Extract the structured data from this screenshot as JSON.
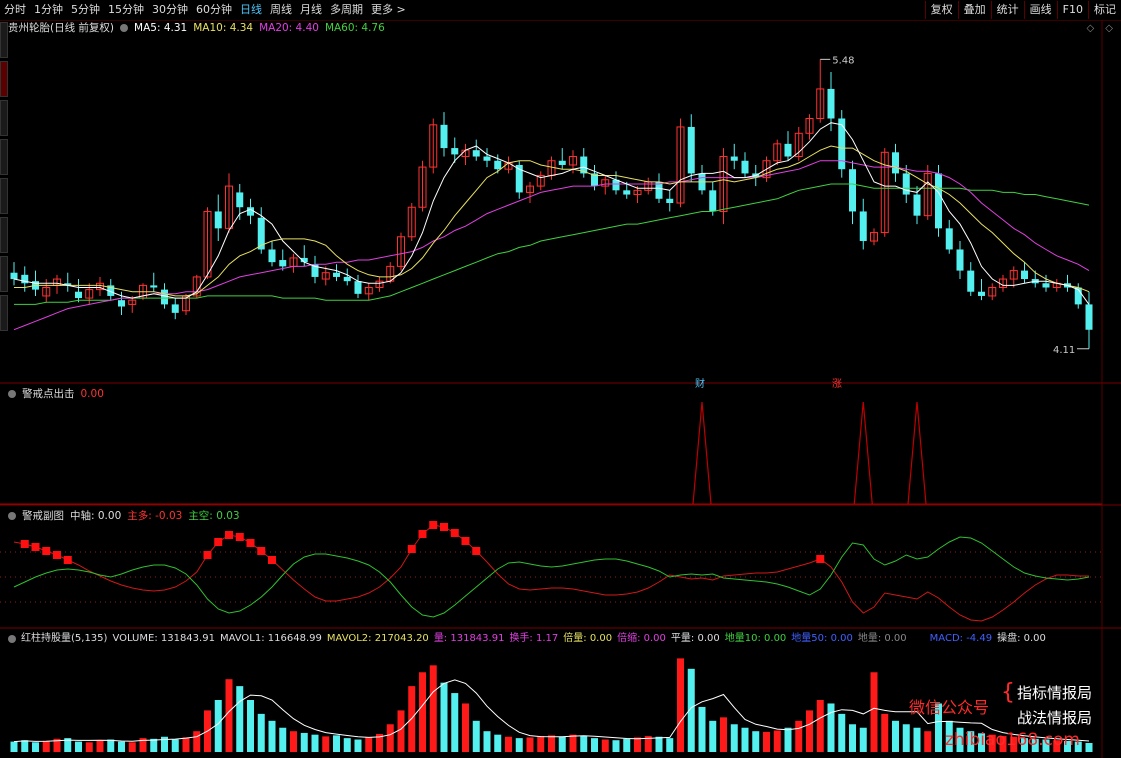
{
  "toolbar": {
    "timeframes": [
      "分时",
      "1分钟",
      "5分钟",
      "15分钟",
      "30分钟",
      "60分钟",
      "日线",
      "周线",
      "月线",
      "多周期",
      "更多 >"
    ],
    "active": "日线",
    "right_buttons": [
      "复权",
      "叠加",
      "统计",
      "画线",
      "F10",
      "标记"
    ]
  },
  "price_header": {
    "title": "贵州轮胎(日线 前复权)",
    "ma5": "MA5: 4.31",
    "ma10": "MA10: 4.34",
    "ma20": "MA20: 4.40",
    "ma60": "MA60: 4.76"
  },
  "alert_header": {
    "title": "警戒点出击",
    "value": "0.00"
  },
  "osc_header": {
    "title": "警戒副图",
    "mid": "中轴: 0.00",
    "long": "主多: -0.03",
    "short": "主空: 0.03"
  },
  "vol_header": {
    "title": "红柱持股量(5,135)",
    "volume": "VOLUME: 131843.91",
    "mavol1": "MAVOL1: 116648.99",
    "mavol2": "MAVOL2: 217043.20",
    "liang": "量: 131843.91",
    "huanshou": "换手: 1.17",
    "beiliang": "倍量: 0.00",
    "beisuo": "倍缩: 0.00",
    "pingliang": "平量: 0.00",
    "dibiliang": "地量10: 0.00",
    "dibi50": "地量50: 0.00",
    "diliang": "地量: 0.00",
    "macd": "MACD: -4.49",
    "caopan": "操盘: 0.00"
  },
  "markers": {
    "cai": "财",
    "zhang": "涨"
  },
  "watermark": {
    "line1": "微信公众号",
    "brace": "{",
    "line2": "指标情报局",
    "line3": "战法情报局",
    "url": "zhibiao168.com"
  },
  "colors": {
    "up": "#ff3232",
    "down": "#54f0f0",
    "ma5": "#ffffff",
    "ma10": "#e8e060",
    "ma20": "#e040e0",
    "ma60": "#40d040"
  },
  "chart_data": {
    "type": "candlestick",
    "high_label": "5.48",
    "low_label": "4.11",
    "ylim": [
      4.0,
      5.6
    ],
    "candles": [
      [
        4.47,
        4.52,
        4.41,
        4.44
      ],
      [
        4.46,
        4.5,
        4.38,
        4.42
      ],
      [
        4.43,
        4.48,
        4.36,
        4.39
      ],
      [
        4.36,
        4.44,
        4.33,
        4.4
      ],
      [
        4.41,
        4.46,
        4.37,
        4.44
      ],
      [
        4.42,
        4.47,
        4.38,
        4.41
      ],
      [
        4.38,
        4.44,
        4.33,
        4.35
      ],
      [
        4.35,
        4.42,
        4.32,
        4.39
      ],
      [
        4.39,
        4.45,
        4.36,
        4.42
      ],
      [
        4.41,
        4.44,
        4.34,
        4.36
      ],
      [
        4.34,
        4.38,
        4.27,
        4.31
      ],
      [
        4.32,
        4.36,
        4.28,
        4.34
      ],
      [
        4.35,
        4.42,
        4.34,
        4.41
      ],
      [
        4.41,
        4.47,
        4.38,
        4.4
      ],
      [
        4.39,
        4.42,
        4.3,
        4.32
      ],
      [
        4.32,
        4.35,
        4.25,
        4.28
      ],
      [
        4.29,
        4.37,
        4.27,
        4.36
      ],
      [
        4.36,
        4.46,
        4.35,
        4.45
      ],
      [
        4.45,
        4.78,
        4.44,
        4.76
      ],
      [
        4.76,
        4.84,
        4.62,
        4.68
      ],
      [
        4.68,
        4.94,
        4.66,
        4.88
      ],
      [
        4.85,
        4.89,
        4.72,
        4.78
      ],
      [
        4.78,
        4.82,
        4.7,
        4.74
      ],
      [
        4.73,
        4.78,
        4.56,
        4.58
      ],
      [
        4.58,
        4.62,
        4.5,
        4.52
      ],
      [
        4.53,
        4.58,
        4.48,
        4.5
      ],
      [
        4.5,
        4.56,
        4.47,
        4.54
      ],
      [
        4.54,
        4.6,
        4.5,
        4.52
      ],
      [
        4.51,
        4.55,
        4.42,
        4.45
      ],
      [
        4.44,
        4.5,
        4.41,
        4.47
      ],
      [
        4.47,
        4.51,
        4.43,
        4.45
      ],
      [
        4.45,
        4.49,
        4.41,
        4.43
      ],
      [
        4.43,
        4.46,
        4.35,
        4.37
      ],
      [
        4.37,
        4.42,
        4.34,
        4.4
      ],
      [
        4.4,
        4.45,
        4.38,
        4.43
      ],
      [
        4.43,
        4.52,
        4.42,
        4.5
      ],
      [
        4.5,
        4.66,
        4.48,
        4.64
      ],
      [
        4.64,
        4.8,
        4.62,
        4.78
      ],
      [
        4.78,
        5.0,
        4.76,
        4.97
      ],
      [
        4.97,
        5.2,
        4.94,
        5.17
      ],
      [
        5.17,
        5.23,
        5.02,
        5.06
      ],
      [
        5.06,
        5.11,
        4.99,
        5.03
      ],
      [
        5.02,
        5.08,
        4.98,
        5.05
      ],
      [
        5.05,
        5.1,
        5.0,
        5.02
      ],
      [
        5.02,
        5.06,
        4.97,
        5.0
      ],
      [
        5.0,
        5.03,
        4.94,
        4.96
      ],
      [
        4.96,
        5.02,
        4.94,
        4.99
      ],
      [
        4.98,
        5.0,
        4.82,
        4.85
      ],
      [
        4.85,
        4.9,
        4.8,
        4.88
      ],
      [
        4.88,
        4.95,
        4.86,
        4.93
      ],
      [
        4.93,
        5.02,
        4.91,
        5.0
      ],
      [
        5.0,
        5.06,
        4.96,
        4.98
      ],
      [
        4.98,
        5.05,
        4.94,
        5.02
      ],
      [
        5.02,
        5.06,
        4.92,
        4.94
      ],
      [
        4.94,
        4.98,
        4.86,
        4.88
      ],
      [
        4.88,
        4.93,
        4.84,
        4.91
      ],
      [
        4.91,
        4.95,
        4.84,
        4.86
      ],
      [
        4.86,
        4.9,
        4.82,
        4.84
      ],
      [
        4.84,
        4.88,
        4.8,
        4.86
      ],
      [
        4.86,
        4.92,
        4.84,
        4.9
      ],
      [
        4.9,
        4.94,
        4.8,
        4.82
      ],
      [
        4.82,
        4.86,
        4.76,
        4.8
      ],
      [
        4.8,
        5.2,
        4.78,
        5.16
      ],
      [
        5.16,
        5.22,
        4.9,
        4.94
      ],
      [
        4.94,
        4.98,
        4.84,
        4.86
      ],
      [
        4.86,
        4.9,
        4.74,
        4.76
      ],
      [
        4.76,
        5.06,
        4.7,
        5.02
      ],
      [
        5.02,
        5.08,
        4.96,
        5.0
      ],
      [
        5.0,
        5.04,
        4.92,
        4.94
      ],
      [
        4.94,
        4.98,
        4.88,
        4.92
      ],
      [
        4.92,
        5.02,
        4.9,
        5.0
      ],
      [
        5.0,
        5.1,
        4.98,
        5.08
      ],
      [
        5.08,
        5.14,
        5.0,
        5.02
      ],
      [
        5.02,
        5.16,
        5.0,
        5.13
      ],
      [
        5.13,
        5.22,
        5.1,
        5.2
      ],
      [
        5.2,
        5.48,
        5.18,
        5.34
      ],
      [
        5.34,
        5.42,
        5.14,
        5.2
      ],
      [
        5.2,
        5.24,
        4.92,
        4.96
      ],
      [
        4.96,
        5.0,
        4.7,
        4.76
      ],
      [
        4.76,
        4.82,
        4.58,
        4.62
      ],
      [
        4.62,
        4.68,
        4.6,
        4.66
      ],
      [
        4.66,
        5.06,
        4.64,
        5.04
      ],
      [
        5.04,
        5.08,
        4.9,
        4.94
      ],
      [
        4.94,
        4.98,
        4.8,
        4.84
      ],
      [
        4.84,
        4.88,
        4.7,
        4.74
      ],
      [
        4.74,
        4.98,
        4.72,
        4.94
      ],
      [
        4.94,
        4.98,
        4.64,
        4.68
      ],
      [
        4.68,
        4.72,
        4.56,
        4.58
      ],
      [
        4.58,
        4.62,
        4.44,
        4.48
      ],
      [
        4.48,
        4.52,
        4.36,
        4.38
      ],
      [
        4.38,
        4.44,
        4.34,
        4.36
      ],
      [
        4.36,
        4.42,
        4.34,
        4.4
      ],
      [
        4.4,
        4.46,
        4.38,
        4.44
      ],
      [
        4.44,
        4.5,
        4.4,
        4.48
      ],
      [
        4.48,
        4.52,
        4.42,
        4.44
      ],
      [
        4.44,
        4.48,
        4.4,
        4.42
      ],
      [
        4.42,
        4.46,
        4.38,
        4.4
      ],
      [
        4.4,
        4.44,
        4.38,
        4.42
      ],
      [
        4.42,
        4.46,
        4.38,
        4.4
      ],
      [
        4.4,
        4.42,
        4.3,
        4.32
      ],
      [
        4.32,
        4.38,
        4.11,
        4.2
      ]
    ],
    "ma5": [
      4.44,
      4.43,
      4.42,
      4.42,
      4.42,
      4.41,
      4.4,
      4.4,
      4.4,
      4.38,
      4.36,
      4.35,
      4.36,
      4.37,
      4.36,
      4.35,
      4.35,
      4.38,
      4.46,
      4.55,
      4.67,
      4.75,
      4.77,
      4.74,
      4.7,
      4.62,
      4.57,
      4.52,
      4.5,
      4.49,
      4.48,
      4.46,
      4.43,
      4.42,
      4.42,
      4.43,
      4.47,
      4.55,
      4.66,
      4.81,
      4.92,
      5.0,
      5.05,
      5.07,
      5.03,
      5.01,
      4.99,
      4.96,
      4.94,
      4.92,
      4.93,
      4.94,
      4.96,
      4.97,
      4.95,
      4.93,
      4.91,
      4.89,
      4.87,
      4.87,
      4.87,
      4.86,
      4.91,
      4.93,
      4.94,
      4.94,
      4.95,
      4.92,
      4.92,
      4.93,
      4.96,
      4.99,
      5.0,
      5.04,
      5.09,
      5.15,
      5.18,
      5.17,
      5.1,
      5.0,
      4.9,
      4.88,
      4.88,
      4.86,
      4.85,
      4.9,
      4.85,
      4.76,
      4.7,
      4.61,
      4.5,
      4.44,
      4.41,
      4.41,
      4.42,
      4.43,
      4.43,
      4.42,
      4.41,
      4.39,
      4.32
    ],
    "ma10": [
      4.4,
      4.4,
      4.41,
      4.41,
      4.41,
      4.41,
      4.41,
      4.41,
      4.41,
      4.4,
      4.39,
      4.38,
      4.38,
      4.38,
      4.37,
      4.36,
      4.36,
      4.37,
      4.41,
      4.45,
      4.51,
      4.55,
      4.57,
      4.6,
      4.62,
      4.63,
      4.63,
      4.63,
      4.62,
      4.6,
      4.55,
      4.51,
      4.48,
      4.46,
      4.45,
      4.45,
      4.46,
      4.49,
      4.54,
      4.61,
      4.67,
      4.74,
      4.8,
      4.86,
      4.92,
      4.95,
      4.99,
      5.0,
      5.0,
      4.98,
      4.97,
      4.96,
      4.96,
      4.95,
      4.93,
      4.93,
      4.93,
      4.92,
      4.91,
      4.9,
      4.9,
      4.89,
      4.9,
      4.9,
      4.9,
      4.9,
      4.91,
      4.9,
      4.91,
      4.92,
      4.94,
      4.96,
      4.97,
      4.99,
      5.02,
      5.05,
      5.07,
      5.06,
      5.06,
      5.03,
      5.0,
      4.98,
      4.97,
      4.95,
      4.92,
      4.89,
      4.87,
      4.84,
      4.8,
      4.75,
      4.7,
      4.66,
      4.61,
      4.56,
      4.52,
      4.47,
      4.44,
      4.42,
      4.41,
      4.4,
      4.38
    ],
    "ma20": [
      4.2,
      4.22,
      4.24,
      4.26,
      4.28,
      4.3,
      4.31,
      4.32,
      4.33,
      4.34,
      4.35,
      4.35,
      4.36,
      4.37,
      4.37,
      4.37,
      4.38,
      4.38,
      4.39,
      4.41,
      4.43,
      4.45,
      4.46,
      4.47,
      4.48,
      4.49,
      4.5,
      4.5,
      4.51,
      4.51,
      4.52,
      4.52,
      4.53,
      4.53,
      4.54,
      4.55,
      4.56,
      4.57,
      4.59,
      4.62,
      4.64,
      4.67,
      4.69,
      4.72,
      4.75,
      4.77,
      4.79,
      4.81,
      4.83,
      4.85,
      4.86,
      4.87,
      4.88,
      4.88,
      4.88,
      4.89,
      4.89,
      4.89,
      4.89,
      4.89,
      4.89,
      4.9,
      4.9,
      4.91,
      4.92,
      4.92,
      4.92,
      4.92,
      4.92,
      4.92,
      4.93,
      4.94,
      4.95,
      4.96,
      4.98,
      5.0,
      5.0,
      5.0,
      4.99,
      4.98,
      4.97,
      4.97,
      4.97,
      4.96,
      4.95,
      4.95,
      4.94,
      4.92,
      4.89,
      4.85,
      4.8,
      4.76,
      4.72,
      4.68,
      4.65,
      4.61,
      4.58,
      4.55,
      4.53,
      4.51,
      4.48
    ],
    "ma60": [
      4.32,
      4.32,
      4.32,
      4.33,
      4.33,
      4.33,
      4.34,
      4.34,
      4.34,
      4.34,
      4.35,
      4.35,
      4.35,
      4.35,
      4.35,
      4.35,
      4.35,
      4.35,
      4.36,
      4.36,
      4.36,
      4.36,
      4.36,
      4.36,
      4.36,
      4.35,
      4.35,
      4.35,
      4.35,
      4.34,
      4.34,
      4.34,
      4.34,
      4.34,
      4.35,
      4.36,
      4.38,
      4.4,
      4.42,
      4.44,
      4.46,
      4.48,
      4.5,
      4.52,
      4.54,
      4.56,
      4.57,
      4.59,
      4.6,
      4.62,
      4.63,
      4.64,
      4.65,
      4.66,
      4.67,
      4.68,
      4.69,
      4.7,
      4.7,
      4.71,
      4.72,
      4.73,
      4.74,
      4.75,
      4.76,
      4.76,
      4.77,
      4.78,
      4.79,
      4.8,
      4.81,
      4.82,
      4.84,
      4.86,
      4.87,
      4.88,
      4.89,
      4.89,
      4.89,
      4.88,
      4.87,
      4.87,
      4.87,
      4.87,
      4.87,
      4.87,
      4.87,
      4.87,
      4.87,
      4.86,
      4.86,
      4.86,
      4.85,
      4.85,
      4.84,
      4.84,
      4.83,
      4.82,
      4.81,
      4.8,
      4.79
    ],
    "alert_spikes": [
      64,
      79,
      84
    ],
    "osc_red": [
      0.35,
      0.33,
      0.3,
      0.26,
      0.22,
      0.17,
      0.12,
      0.06,
      0.01,
      -0.04,
      -0.08,
      -0.11,
      -0.13,
      -0.14,
      -0.13,
      -0.1,
      -0.04,
      0.05,
      0.22,
      0.35,
      0.42,
      0.4,
      0.34,
      0.26,
      0.17,
      0.07,
      -0.03,
      -0.12,
      -0.2,
      -0.24,
      -0.24,
      -0.22,
      -0.2,
      -0.16,
      -0.1,
      -0.01,
      0.1,
      0.28,
      0.43,
      0.52,
      0.5,
      0.44,
      0.36,
      0.26,
      0.15,
      0.03,
      -0.07,
      -0.12,
      -0.13,
      -0.12,
      -0.11,
      -0.11,
      -0.12,
      -0.14,
      -0.16,
      -0.18,
      -0.18,
      -0.17,
      -0.15,
      -0.11,
      -0.05,
      0.02,
      0.0,
      -0.02,
      -0.01,
      -0.03,
      0.01,
      0.02,
      0.03,
      0.04,
      0.04,
      0.05,
      0.08,
      0.11,
      0.14,
      0.18,
      0.1,
      -0.05,
      -0.25,
      -0.36,
      -0.3,
      -0.16,
      -0.18,
      -0.2,
      -0.22,
      -0.15,
      -0.21,
      -0.3,
      -0.38,
      -0.43,
      -0.44,
      -0.4,
      -0.33,
      -0.25,
      -0.16,
      -0.08,
      -0.02,
      0.02,
      0.02,
      0.01,
      0.01
    ],
    "osc_green": [
      -0.1,
      -0.05,
      0.0,
      0.04,
      0.07,
      0.08,
      0.07,
      0.05,
      0.02,
      0.0,
      0.03,
      0.07,
      0.1,
      0.12,
      0.12,
      0.09,
      0.03,
      -0.08,
      -0.22,
      -0.32,
      -0.36,
      -0.34,
      -0.28,
      -0.2,
      -0.1,
      0.02,
      0.13,
      0.2,
      0.23,
      0.23,
      0.21,
      0.19,
      0.16,
      0.12,
      0.05,
      -0.05,
      -0.18,
      -0.3,
      -0.38,
      -0.4,
      -0.36,
      -0.28,
      -0.19,
      -0.1,
      -0.01,
      0.08,
      0.14,
      0.15,
      0.13,
      0.11,
      0.1,
      0.11,
      0.13,
      0.15,
      0.17,
      0.18,
      0.18,
      0.16,
      0.13,
      0.1,
      0.06,
      0.0,
      0.02,
      0.03,
      0.02,
      0.03,
      -0.01,
      -0.02,
      -0.03,
      -0.04,
      -0.05,
      -0.07,
      -0.1,
      -0.14,
      -0.18,
      -0.12,
      0.02,
      0.2,
      0.34,
      0.32,
      0.18,
      0.12,
      0.16,
      0.22,
      0.18,
      0.2,
      0.28,
      0.35,
      0.4,
      0.39,
      0.34,
      0.26,
      0.18,
      0.1,
      0.04,
      0.01,
      -0.01,
      -0.02,
      -0.03,
      -0.02,
      0.0
    ],
    "volume": [
      30,
      34,
      28,
      32,
      38,
      40,
      30,
      28,
      34,
      36,
      30,
      28,
      40,
      38,
      44,
      36,
      42,
      60,
      120,
      150,
      210,
      190,
      150,
      110,
      90,
      70,
      60,
      55,
      50,
      45,
      48,
      40,
      36,
      42,
      52,
      80,
      120,
      190,
      230,
      250,
      200,
      170,
      140,
      90,
      60,
      50,
      44,
      40,
      42,
      46,
      48,
      44,
      50,
      46,
      40,
      36,
      34,
      38,
      42,
      46,
      44,
      40,
      270,
      240,
      130,
      90,
      100,
      80,
      70,
      60,
      58,
      62,
      70,
      90,
      120,
      150,
      140,
      110,
      80,
      70,
      230,
      110,
      90,
      80,
      70,
      60,
      140,
      90,
      70,
      60,
      54,
      50,
      46,
      44,
      40,
      38,
      36,
      34,
      32,
      30,
      26
    ],
    "volume_ylim": [
      0,
      300
    ]
  }
}
